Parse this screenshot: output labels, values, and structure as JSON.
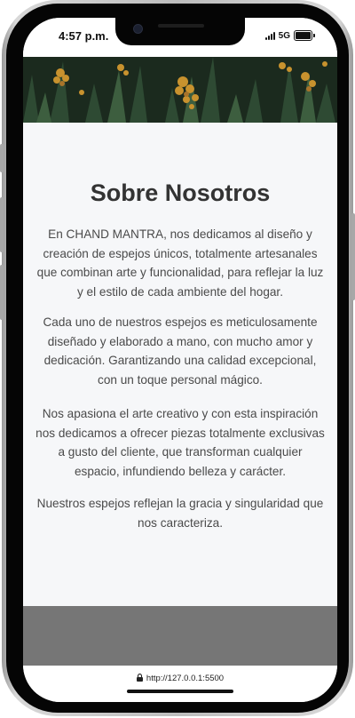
{
  "status_bar": {
    "time": "4:57 p.m.",
    "network": "5G",
    "icons": [
      "signal-icon",
      "battery-icon"
    ]
  },
  "hero": {
    "image": "golden-flowers-foliage"
  },
  "about": {
    "title": "Sobre Nosotros",
    "paragraphs": [
      "En CHAND MANTRA, nos dedicamos al diseño y creación de espejos únicos, totalmente artesanales que combinan arte y funcionalidad, para reflejar la luz y el estilo de cada ambiente del hogar.",
      "Cada uno de nuestros espejos es meticulosamente diseñado y elaborado a mano, con mucho amor y dedicación. Garantizando una calidad excepcional, con un toque personal mágico.",
      "Nos apasiona el arte creativo y con esta inspiración nos dedicamos a ofrecer piezas totalmente exclusivas a gusto del cliente, que transforman cualquier espacio, infundiendo belleza y carácter.",
      "Nuestros espejos reflejan la gracia y singularidad que nos caracteriza."
    ]
  },
  "browser": {
    "url": "http://127.0.0.1:5500"
  },
  "colors": {
    "content_bg": "#f6f7f9",
    "title": "#333333",
    "text": "#4a4a4a",
    "footer": "#767676"
  }
}
